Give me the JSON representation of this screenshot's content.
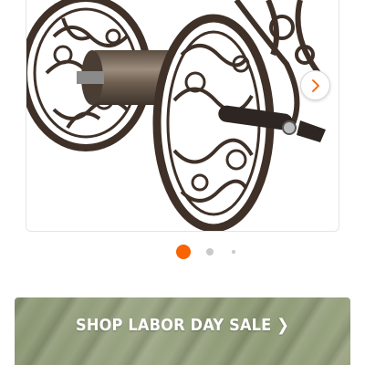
{
  "product_gallery": {
    "image_alt": "decorative bronze garden hose reel",
    "next_icon": "chevron-right-icon",
    "dots_total": 3,
    "active_dot": 1
  },
  "promo": {
    "label": "SHOP LABOR DAY SALE ❯"
  },
  "colors": {
    "accent": "#f96302",
    "dot_inactive": "#c9c9c9",
    "banner": "#8e9a75"
  }
}
